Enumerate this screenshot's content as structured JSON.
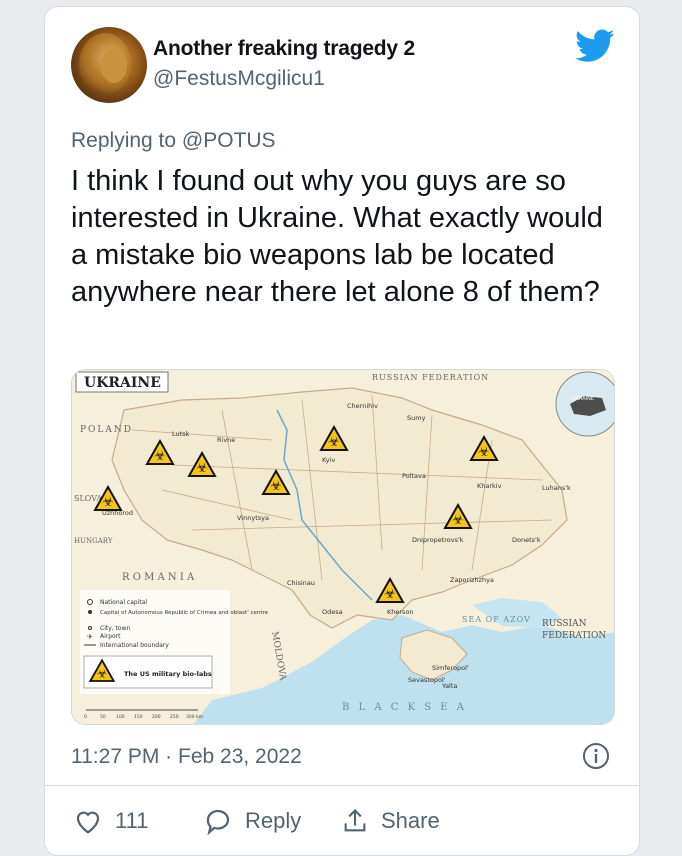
{
  "tweet": {
    "display_name": "Another freaking tragedy 2",
    "handle": "@FestusMcgilicu1",
    "reply_prefix": "Replying to",
    "reply_mention": "@POTUS",
    "text": "I think I found out why you guys are so interested in Ukraine. What exactly would a mistake bio weapons lab be located anywhere near there let alone 8 of them?",
    "timestamp": "11:27 PM · Feb 23, 2022",
    "likes": "111",
    "reply_label": "Reply",
    "share_label": "Share"
  },
  "colors": {
    "twitter_blue": "#1d9bf0",
    "secondary_text": "#536471",
    "map_land": "#f3ead2",
    "map_sea": "#bfe0ef"
  },
  "map": {
    "title": "UKRAINE",
    "neighbors": {
      "poland": "POLAND",
      "slovakia": "SLOVA",
      "hungary": "HUNGARY",
      "romania": "R O M A N I A",
      "moldova": "MOLDOVA",
      "russia_top": "RUSSIAN FEDERATION",
      "russia_right": "RUSSIAN\nFEDERATION"
    },
    "seas": {
      "azov": "SEA OF AZOV",
      "black": "B L A C K   S E A"
    },
    "cities": [
      "Kyiv",
      "Kharkiv",
      "Dnipropetrovs'k",
      "Odesa",
      "Kherson",
      "Zaporizhzhya",
      "Simferopol'",
      "Donets'k",
      "Luhans'k",
      "Chernihiv",
      "Sumy",
      "Poltava",
      "Vinnytsya",
      "Rivne",
      "Lutsk",
      "Uzhhorod",
      "Chisinau",
      "Yalta",
      "Sevastopol'"
    ],
    "lab_count": 8,
    "legend": {
      "items": [
        "National capital",
        "Capital of Autonomous Republic of Crimea and oblast' centre",
        "City, town",
        "Airport",
        "International boundary"
      ],
      "lab_label": "The US military bio-labs"
    },
    "scale": [
      "0",
      "50",
      "100",
      "150",
      "200",
      "250",
      "300 km"
    ],
    "inset_label": "UKRAINE"
  }
}
